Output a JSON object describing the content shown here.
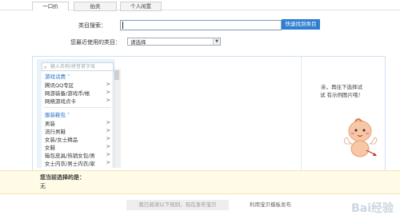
{
  "tabs": [
    {
      "label": "一口价",
      "active": true
    },
    {
      "label": "拍卖",
      "active": false
    },
    {
      "label": "个人闲置",
      "active": false
    }
  ],
  "category_search": {
    "label": "类目搜索：",
    "value": "",
    "button_label": "快速找到类目"
  },
  "recent_category": {
    "label": "您最近使用的类目：",
    "selected": "请选择"
  },
  "category_list": {
    "search_placeholder": "输入名称/拼音首字母",
    "groups": [
      {
        "title": "游戏话费",
        "items": [
          "腾讯QQ专区",
          "网游装备/游戏币/帐",
          "网络游戏点卡"
        ]
      },
      {
        "title": "服装鞋包",
        "items": [
          "男装",
          "流行男鞋",
          "女装/女士精品",
          "女鞋",
          "箱包皮具/热销女包/男",
          "女士内衣/男士内衣/家"
        ]
      }
    ],
    "chevron_glyph": ">",
    "group_toggle_glyph": "˄"
  },
  "hint": {
    "text": "亲，再往下选择试试 有示例图片哦！"
  },
  "selected": {
    "label": "您当前选择的是：",
    "value": "无"
  },
  "actions": {
    "publish_label": "我已阅读以下规则，现在发布宝贝",
    "template_label": "利用宝贝模板发布"
  },
  "watermark": "Bai经验",
  "colors": {
    "accent": "#2f7fd1",
    "group_title": "#1f6fc7",
    "selected_bg": "#fffbe7"
  }
}
